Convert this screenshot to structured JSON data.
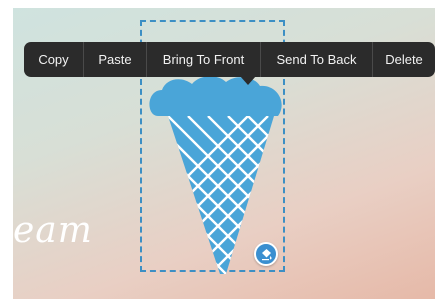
{
  "canvas": {
    "text_fragment": "eam",
    "colors": {
      "icecream_blue": "#4aa5d8",
      "selection_border": "#3c8fc4",
      "menu_background": "#2b2b2b"
    }
  },
  "context_menu": {
    "items": [
      {
        "label": "Copy"
      },
      {
        "label": "Paste"
      },
      {
        "label": "Bring To Front"
      },
      {
        "label": "Send To Back"
      },
      {
        "label": "Delete"
      }
    ]
  },
  "icons": {
    "icecream_sticker": "icecream-icon",
    "handle": "paint-bucket-icon"
  }
}
